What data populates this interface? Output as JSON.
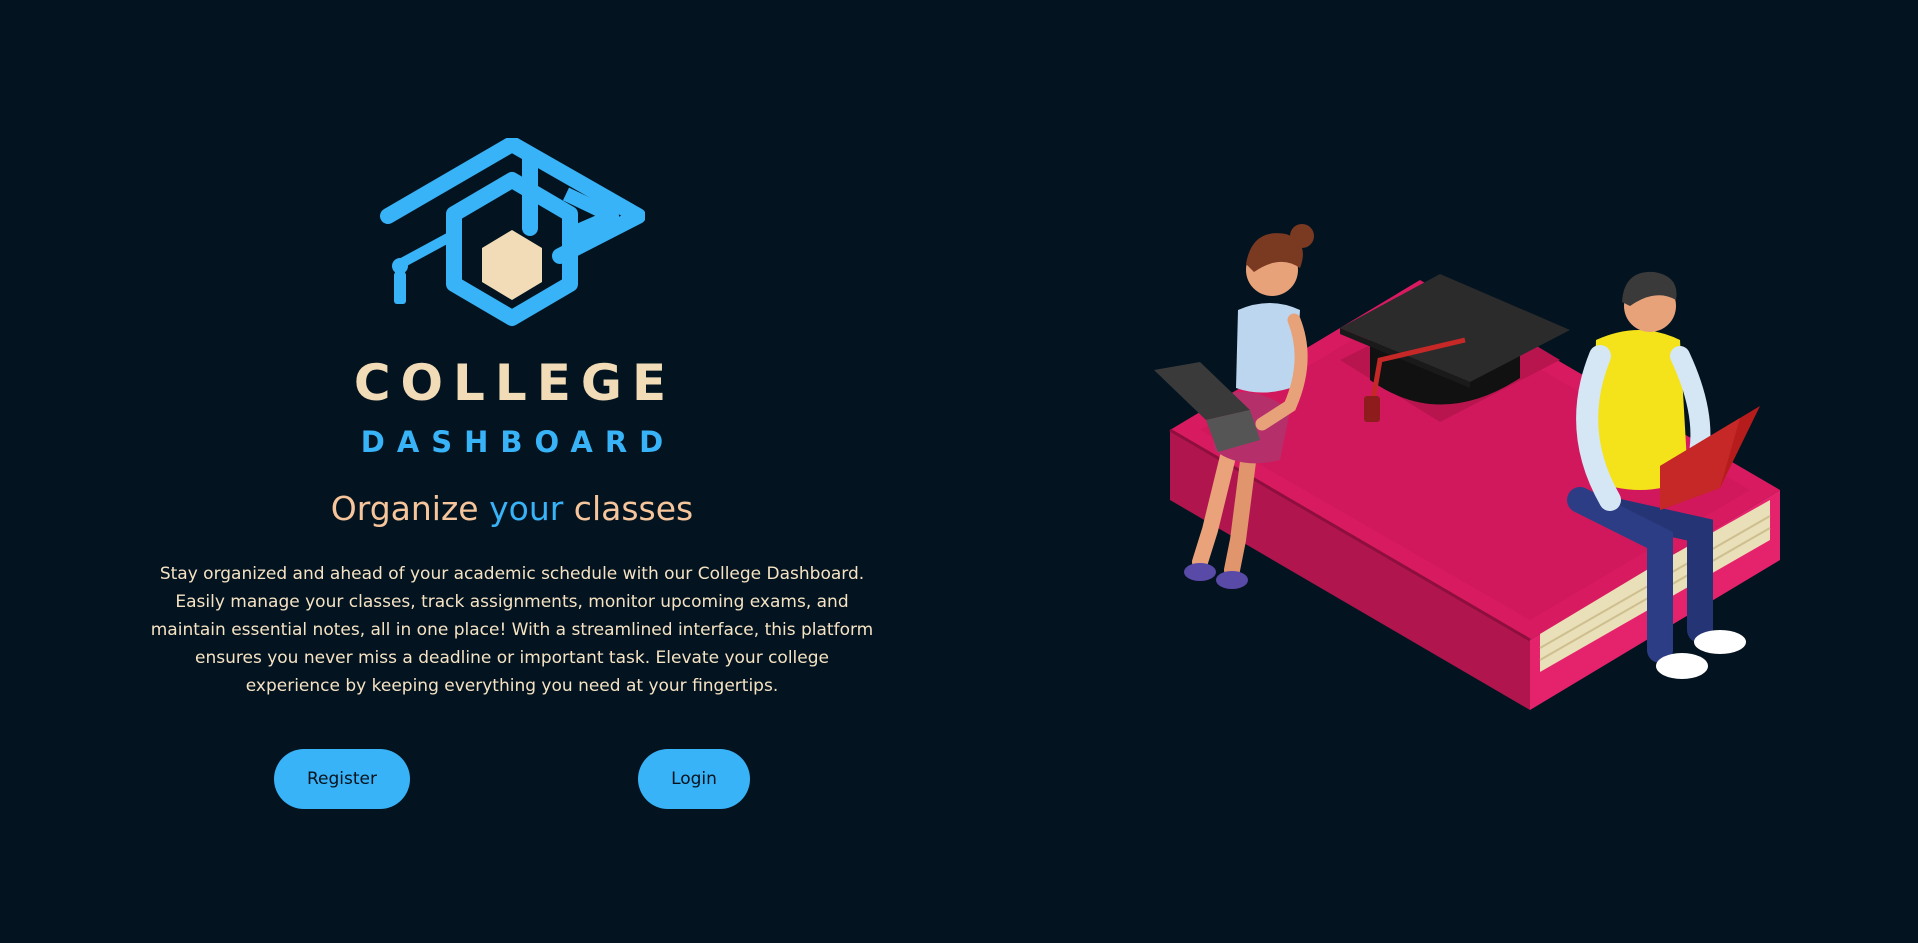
{
  "brand": {
    "name_top": "COLLEGE",
    "name_bottom": "DASHBOARD",
    "logo_icon": "graduation-cap-hexagon-icon"
  },
  "hero": {
    "headline_part1": "Organize ",
    "headline_accent": "your",
    "headline_part2": " classes",
    "description": "Stay organized and ahead of your academic schedule with our College Dashboard. Easily manage your classes, track assignments, monitor upcoming exams, and maintain essential notes, all in one place! With a streamlined interface, this platform ensures you never miss a deadline or important task. Elevate your college experience by keeping everything you need at your fingertips."
  },
  "actions": {
    "register_label": "Register",
    "login_label": "Login"
  },
  "illustration": {
    "name": "students-on-book-illustration"
  },
  "colors": {
    "background": "#031420",
    "accent": "#38b3f7",
    "cream": "#f2dcb7",
    "peach": "#f6c59b",
    "book_pink": "#d81b60"
  }
}
